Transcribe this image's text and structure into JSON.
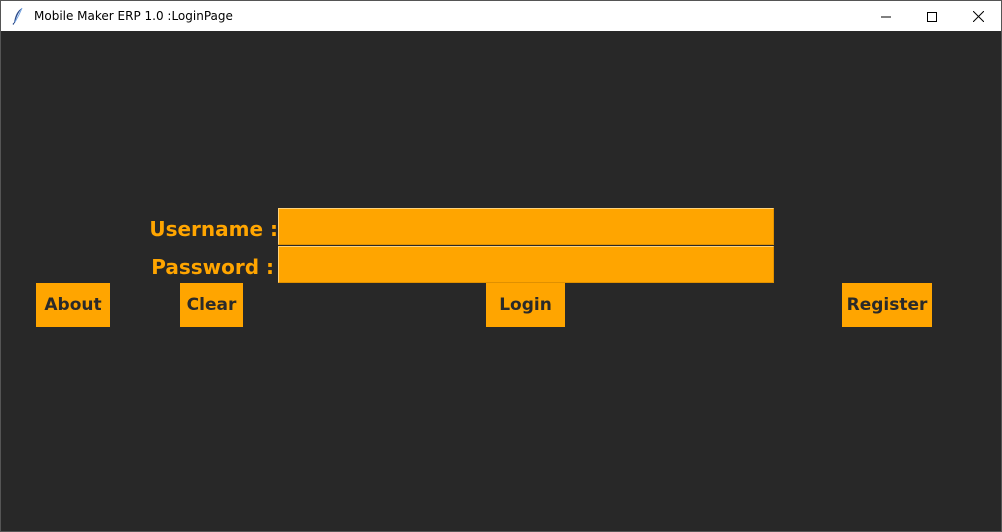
{
  "window": {
    "title": "Mobile Maker ERP 1.0 :LoginPage",
    "app_icon": "feather-icon",
    "controls": [
      "minimize-icon",
      "maximize-icon",
      "close-icon"
    ]
  },
  "form": {
    "username_label": "Username :",
    "password_label": "Password :",
    "username_value": "",
    "password_value": ""
  },
  "buttons": {
    "about": "About",
    "clear": "Clear",
    "login": "Login",
    "register": "Register"
  },
  "colors": {
    "background": "#282828",
    "accent": "#FFA500",
    "button_text": "#2a2a2a"
  }
}
